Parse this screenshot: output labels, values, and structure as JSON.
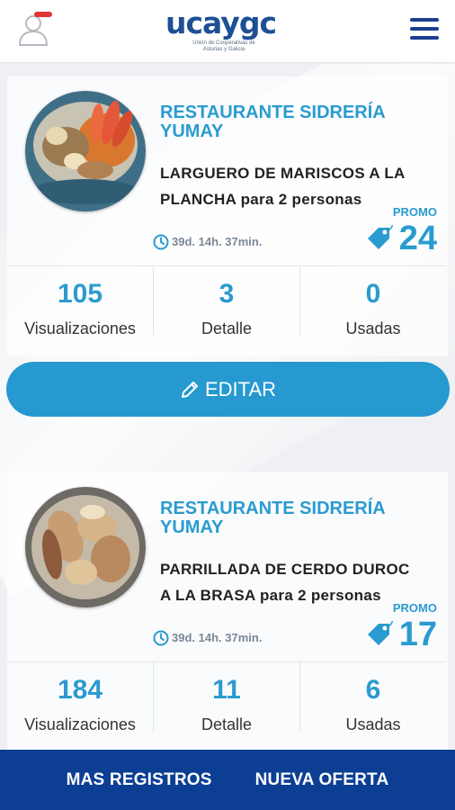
{
  "header": {
    "logo_text": "ucaygc",
    "logo_subtitle": "Unión de Cooperativas de Asturias y Galicia"
  },
  "cards": [
    {
      "restaurant": "RESTAURANTE SIDRERÍA YUMAY",
      "offer": "LARGUERO DE MARISCOS A LA PLANCHA para 2 personas",
      "timer": "39d. 14h. 37min.",
      "promo_label": "PROMO",
      "promo_value": "24",
      "stats": [
        {
          "value": "105",
          "label": "Visualizaciones"
        },
        {
          "value": "3",
          "label": "Detalle"
        },
        {
          "value": "0",
          "label": "Usadas"
        }
      ],
      "edit_label": "EDITAR"
    },
    {
      "restaurant": "RESTAURANTE SIDRERÍA YUMAY",
      "offer": "PARRILLADA DE CERDO DUROC A LA BRASA para 2 personas",
      "timer": "39d. 14h. 37min.",
      "promo_label": "PROMO",
      "promo_value": "17",
      "stats": [
        {
          "value": "184",
          "label": "Visualizaciones"
        },
        {
          "value": "11",
          "label": "Detalle"
        },
        {
          "value": "6",
          "label": "Usadas"
        }
      ]
    }
  ],
  "bottom_bar": {
    "more_label": "MAS REGISTROS",
    "new_offer_label": "NUEVA OFERTA"
  },
  "colors": {
    "accent": "#2599d0",
    "nav": "#0c3f94",
    "brand": "#1d4f94"
  }
}
